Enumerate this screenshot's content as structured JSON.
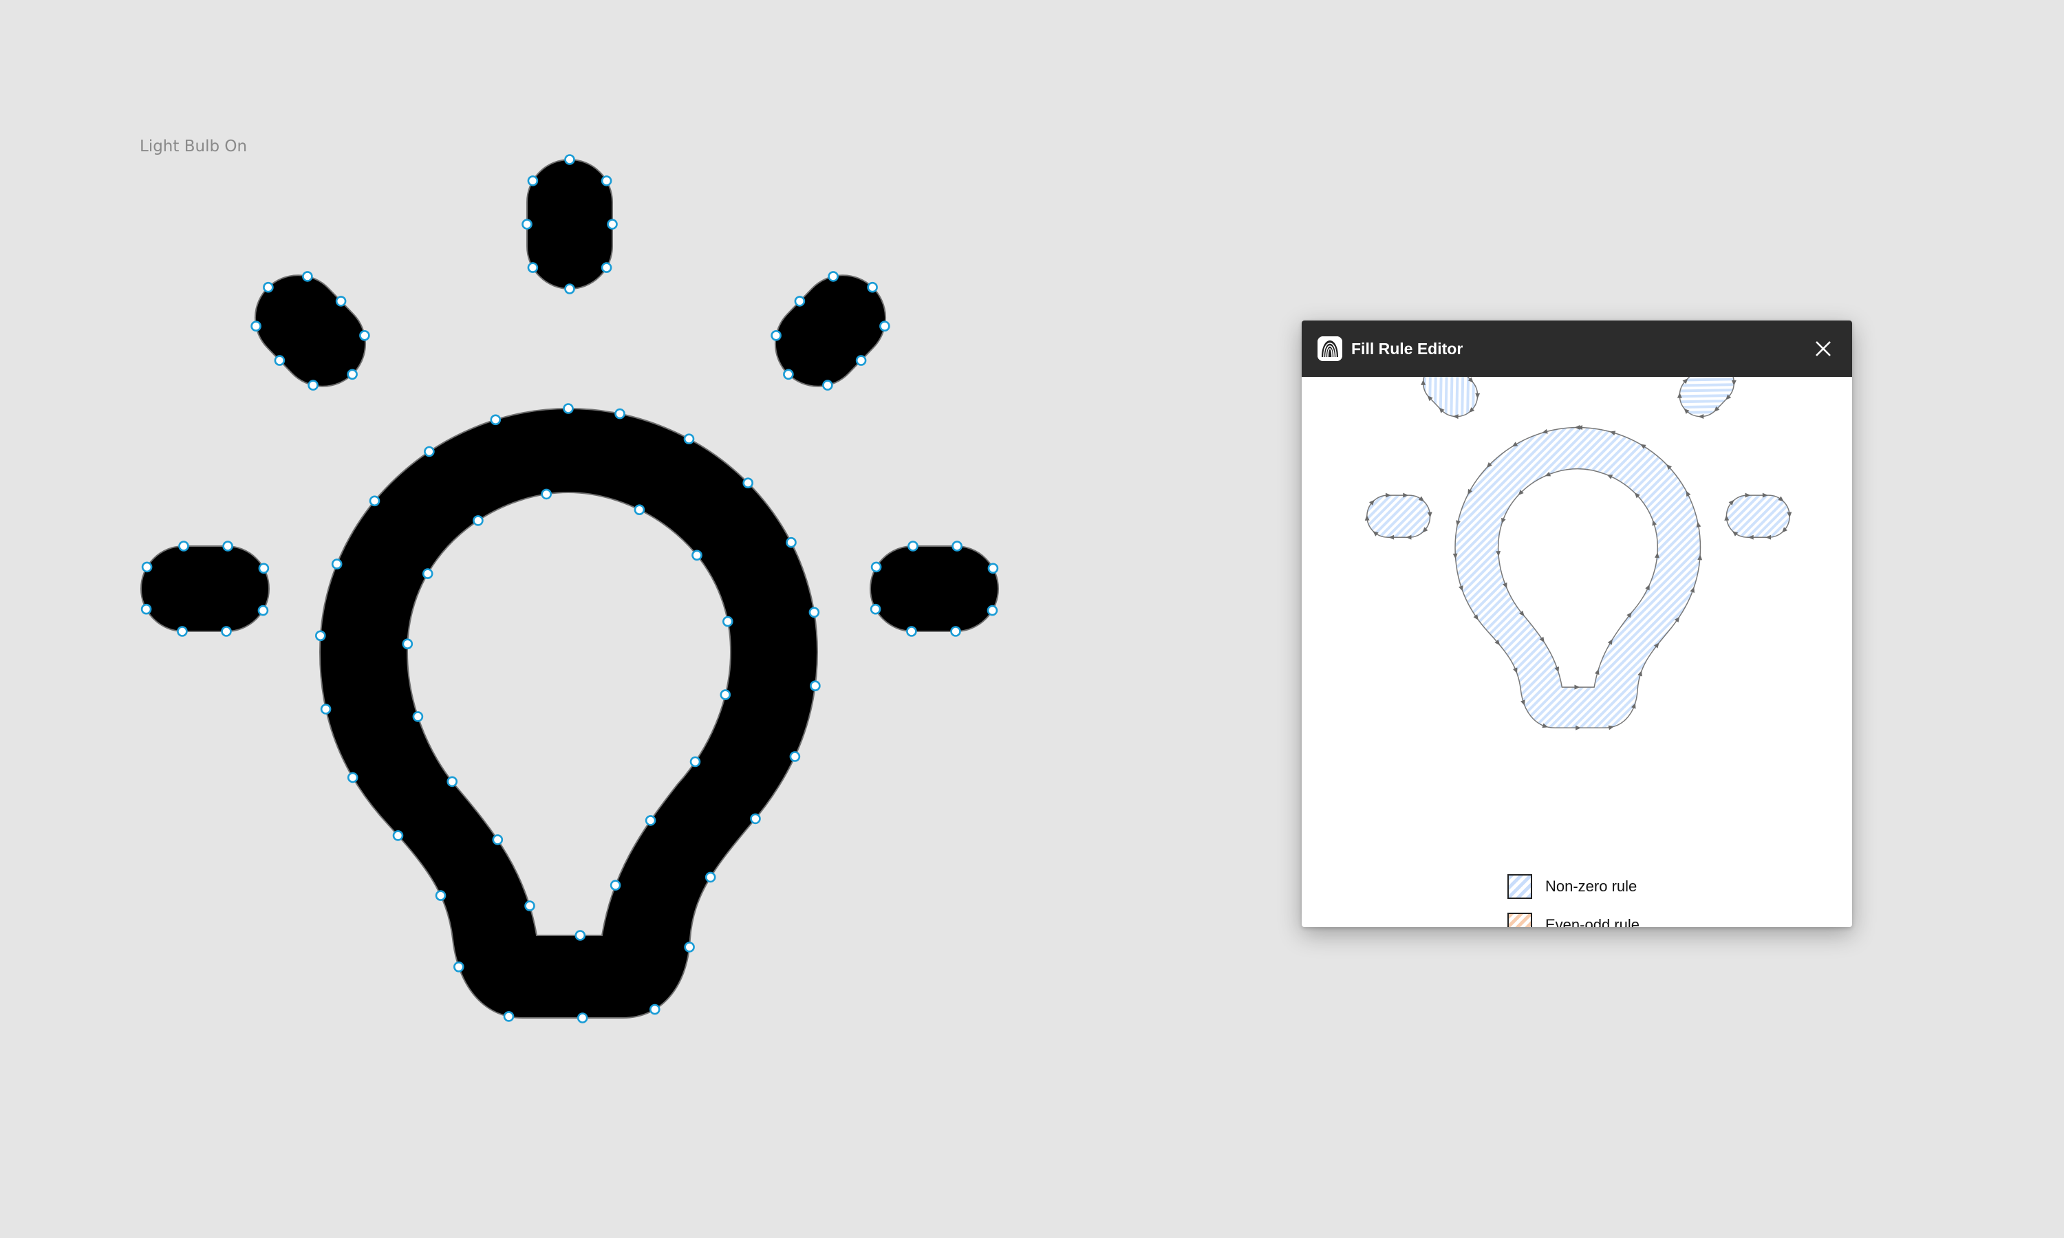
{
  "canvas": {
    "frame_label": "Light Bulb On"
  },
  "plugin_window": {
    "title": "Fill Rule Editor",
    "icon": "plugin-logo-icon",
    "close_icon": "close-icon",
    "legend": [
      {
        "label": "Non-zero rule",
        "color": "#c9ddfb"
      },
      {
        "label": "Even-odd rule",
        "color": "#f8ccad"
      }
    ]
  },
  "colors": {
    "canvas_bg": "#e5e5e5",
    "shape_fill": "#000000",
    "anchor_stroke": "#1a9cd6",
    "titlebar_bg": "#2c2c2c"
  }
}
